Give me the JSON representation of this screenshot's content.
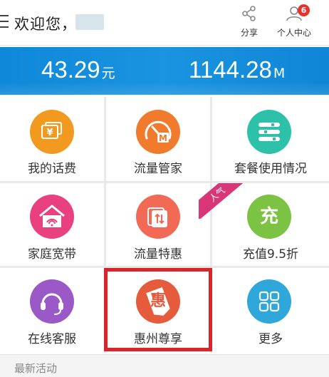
{
  "header": {
    "greeting": "欢迎您，",
    "share_label": "分享",
    "personal_label": "个人中心",
    "notification_count": "6"
  },
  "banner": {
    "balance_value": "43.29",
    "balance_unit": "元",
    "data_value": "1144.28",
    "data_unit": "M"
  },
  "grid": {
    "items": [
      {
        "label": "我的话费",
        "icon": "yuan-cards-icon",
        "color": "#f29a1f"
      },
      {
        "label": "流量管家",
        "icon": "speedometer-icon",
        "color": "#f07b2d"
      },
      {
        "label": "套餐使用情况",
        "icon": "usage-bars-icon",
        "color": "#2cc1a8"
      },
      {
        "label": "家庭宽带",
        "icon": "home-wifi-icon",
        "color": "#e9407f"
      },
      {
        "label": "流量特惠",
        "icon": "transfer-card-icon",
        "color": "#f26a55"
      },
      {
        "label": "充值9.5折",
        "icon": "recharge-icon",
        "color": "#7cc243",
        "glyph": "充"
      },
      {
        "label": "在线客服",
        "icon": "headset-icon",
        "color": "#9b59c8"
      },
      {
        "label": "惠州尊享",
        "icon": "huizhou-tag-icon",
        "color": "#e55b3c",
        "glyph": "惠"
      },
      {
        "label": "更多",
        "icon": "more-grid-icon",
        "color": "#2fa7db"
      }
    ],
    "ribbon_label": "人气"
  },
  "footer": {
    "activity_label": "最新活动"
  }
}
